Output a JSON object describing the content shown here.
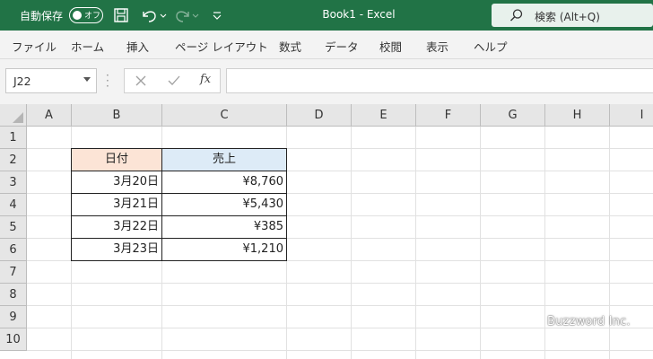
{
  "titlebar": {
    "autosave_label": "自動保存",
    "autosave_toggle": "オフ",
    "document_title": "Book1 - Excel",
    "search_placeholder": "検索 (Alt+Q)"
  },
  "ribbon": {
    "tabs": [
      "ファイル",
      "ホーム",
      "挿入",
      "ページ レイアウト",
      "数式",
      "データ",
      "校閲",
      "表示",
      "ヘルプ"
    ]
  },
  "formula_bar": {
    "name_box": "J22",
    "cancel_icon": "close-icon",
    "enter_icon": "check-icon",
    "function_label": "fx",
    "formula": ""
  },
  "sheet": {
    "columns": [
      "A",
      "B",
      "C",
      "D",
      "E",
      "F",
      "G",
      "H",
      "I"
    ],
    "rows": [
      "1",
      "2",
      "3",
      "4",
      "5",
      "6",
      "7",
      "8",
      "9",
      "10"
    ],
    "header_colors": {
      "date": "#fce4d6",
      "sales": "#ddebf7"
    },
    "table": {
      "headers": [
        "日付",
        "売上"
      ],
      "rows": [
        [
          "3月20日",
          "¥8,760"
        ],
        [
          "3月21日",
          "¥5,430"
        ],
        [
          "3月22日",
          "¥385"
        ],
        [
          "3月23日",
          "¥1,210"
        ]
      ]
    }
  },
  "watermark": "Buzzword Inc."
}
